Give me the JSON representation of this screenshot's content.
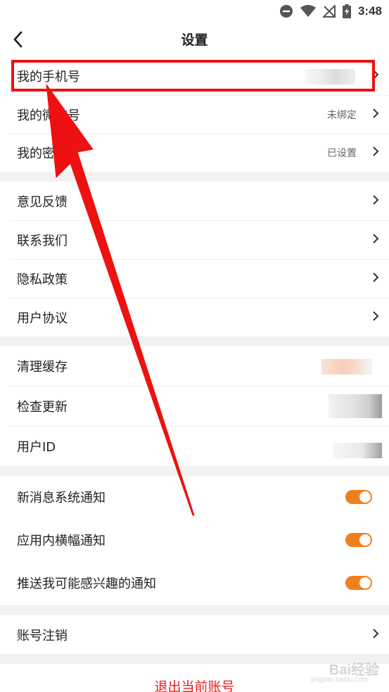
{
  "status_bar": {
    "time": "3:48",
    "icons": [
      "do-not-disturb-icon",
      "wifi-icon",
      "no-signal-icon",
      "battery-charging-icon"
    ]
  },
  "header": {
    "title": "设置",
    "back_icon": "chevron-left-icon"
  },
  "account_section": [
    {
      "label": "我的手机号",
      "value": ""
    },
    {
      "label": "我的微信号",
      "value": "未绑定"
    },
    {
      "label": "我的密码",
      "value": "已设置"
    }
  ],
  "support_section": [
    {
      "label": "意见反馈"
    },
    {
      "label": "联系我们"
    },
    {
      "label": "隐私政策"
    },
    {
      "label": "用户协议"
    }
  ],
  "info_section": [
    {
      "label": "清理缓存"
    },
    {
      "label": "检查更新"
    },
    {
      "label": "用户ID"
    }
  ],
  "notification_section": [
    {
      "label": "新消息系统通知",
      "enabled": true
    },
    {
      "label": "应用内横幅通知",
      "enabled": true
    },
    {
      "label": "推送我可能感兴趣的通知",
      "enabled": true
    }
  ],
  "danger_section": [
    {
      "label": "账号注销"
    }
  ],
  "logout_label": "退出当前账号",
  "colors": {
    "accent": "#f0801e",
    "logout": "#e02020",
    "annotation": "#ee1111"
  },
  "watermark": {
    "brand": "Bai经验",
    "url": "jingyan.baidu.com"
  }
}
